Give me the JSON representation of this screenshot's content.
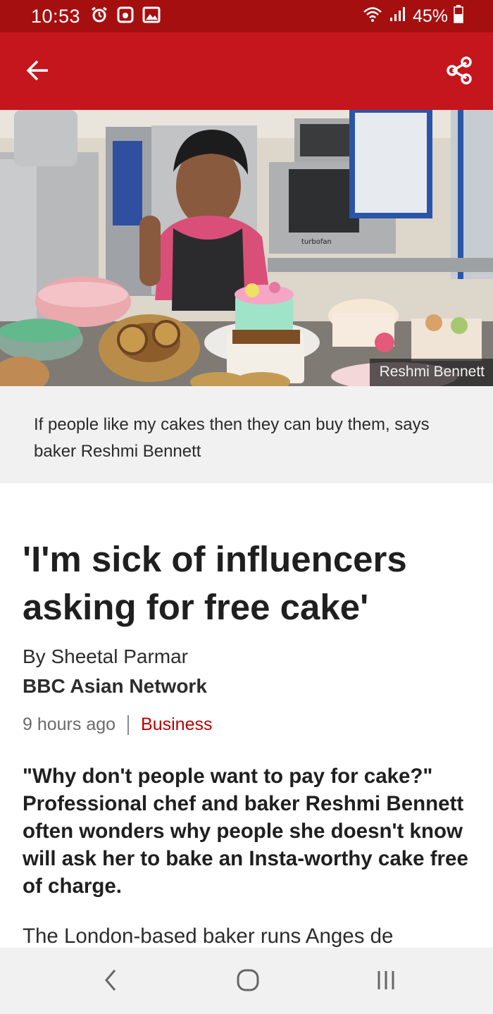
{
  "status_bar": {
    "time": "10:53",
    "battery": "45%",
    "icons": [
      "alarm-clock-icon",
      "notification-icon",
      "gallery-icon",
      "wifi-icon",
      "signal-icon",
      "battery-icon"
    ]
  },
  "app_bar": {
    "back_icon": "arrow-left-icon",
    "share_icon": "share-icon"
  },
  "hero": {
    "credit": "Reshmi Bennett",
    "oven_brand": "turbofan"
  },
  "caption": "If people like my cakes then they can buy them, says baker Reshmi Bennett",
  "article": {
    "headline": "'I'm sick of influencers asking for free cake'",
    "byline": "By Sheetal Parmar",
    "organisation": "BBC Asian Network",
    "time": "9 hours ago",
    "topic": "Business",
    "lede": "\"Why don't people want to pay for cake?\" Professional chef and baker Reshmi Bennett often wonders why people she doesn't know will ask her to bake an Insta-worthy cake free of charge.",
    "body_start": "The London-based baker runs Anges de"
  },
  "nav_bar": {
    "icons": [
      "back-chevron-icon",
      "home-circle-icon",
      "recents-icon"
    ]
  },
  "colors": {
    "status_bar": "#a60f0f",
    "app_bar": "#c4161c",
    "topic": "#b80000"
  }
}
